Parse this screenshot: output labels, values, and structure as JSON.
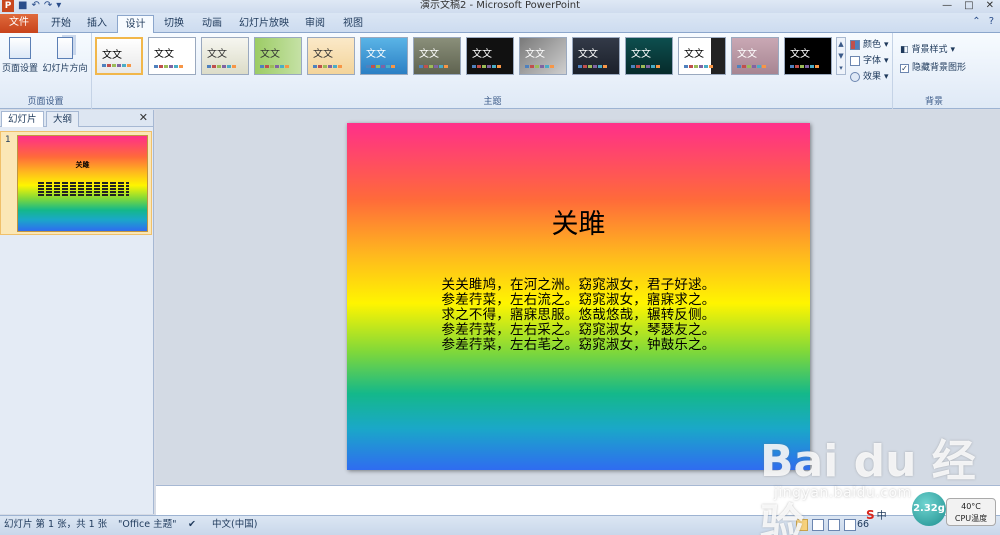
{
  "window": {
    "title": "演示文稿2 - Microsoft PowerPoint",
    "app_icon_letter": "P",
    "qat": [
      "save-icon",
      "undo-icon",
      "redo-icon",
      "customize-icon"
    ],
    "controls": [
      "—",
      "□",
      "✕"
    ]
  },
  "tabs": {
    "file": "文件",
    "items": [
      "开始",
      "插入",
      "设计",
      "切换",
      "动画",
      "幻灯片放映",
      "审阅",
      "视图"
    ],
    "active": "设计",
    "right_icons": [
      "ribbon-minimize-icon",
      "help-icon"
    ]
  },
  "ribbon": {
    "page_setup": {
      "btn_page_setup": "页面设置",
      "btn_orientation": "幻灯片方向",
      "label": "页面设置"
    },
    "themes": {
      "sample_text": "文文",
      "label": "主题",
      "swatches": [
        {
          "bg": "linear-gradient(#ffffff,#e8e8e8)",
          "fg": "#000",
          "selected": true
        },
        {
          "bg": "#ffffff",
          "fg": "#000"
        },
        {
          "bg": "linear-gradient(#f6f6f0,#dcdcc8)",
          "fg": "#333"
        },
        {
          "bg": "linear-gradient(90deg,#9ccc65,#c5e1a5)",
          "fg": "#333"
        },
        {
          "bg": "linear-gradient(#fbe9c8,#f3d49a)",
          "fg": "#333"
        },
        {
          "bg": "linear-gradient(#5ab4e6,#2b7fc4)",
          "fg": "#fff"
        },
        {
          "bg": "linear-gradient(#8a8f7a,#5f6350)",
          "fg": "#fff"
        },
        {
          "bg": "#111111",
          "fg": "#fff"
        },
        {
          "bg": "linear-gradient(135deg,#7a7a7a,#cfcfcf)",
          "fg": "#fff"
        },
        {
          "bg": "linear-gradient(#333a48,#1b202a)",
          "fg": "#fff"
        },
        {
          "bg": "linear-gradient(#0d4f4f,#062b2b)",
          "fg": "#fff"
        },
        {
          "bg": "linear-gradient(90deg,#ffffff 70%,#222 70%)",
          "fg": "#000"
        },
        {
          "bg": "linear-gradient(#c9a8b4,#a78592)",
          "fg": "#fff"
        },
        {
          "bg": "#000000",
          "fg": "#fff"
        }
      ],
      "bar_colors": [
        "#4f81bd",
        "#c0504d",
        "#9bbb59",
        "#8064a2",
        "#4bacc6",
        "#f79646"
      ]
    },
    "theme_options": {
      "colors": "颜色",
      "fonts": "字体",
      "effects": "效果"
    },
    "background": {
      "styles": "背景样式",
      "hide_graphics": "隐藏背景图形",
      "hide_checked": true,
      "label": "背景"
    }
  },
  "left_pane": {
    "tab_slides": "幻灯片",
    "tab_outline": "大纲",
    "close": "✕",
    "thumb_number": "1"
  },
  "slide": {
    "title": "关雎",
    "body_lines": [
      "关关雎鸠，在河之洲。窈窕淑女，君子好逑。",
      "参差荇菜，左右流之。窈窕淑女，寤寐求之。",
      "求之不得，寤寐思服。悠哉悠哉，辗转反侧。",
      "参差荇菜，左右采之。窈窕淑女，琴瑟友之。",
      "参差荇菜，左右芼之。窈窕淑女，钟鼓乐之。"
    ],
    "gradient": "linear-gradient(#ff2f8a 0%, #ff6a3a 22%, #ffb81e 38%, #fff500 52%, #7fd83a 66%, #14b88a 78%, #1aa8c8 88%, #2f6cf0 100%)"
  },
  "status": {
    "slide_info": "幻灯片 第 1 张，共 1 张",
    "theme_name": "\"Office 主题\"",
    "language": "中文(中国)",
    "zoom": "66",
    "ime": "中",
    "cpu_percent": "2.32g",
    "cpu_temp": "40°C",
    "cpu_label": "CPU温度"
  },
  "watermark": {
    "logo": "Bai du 经验",
    "url": "jingyan.baidu.com"
  }
}
